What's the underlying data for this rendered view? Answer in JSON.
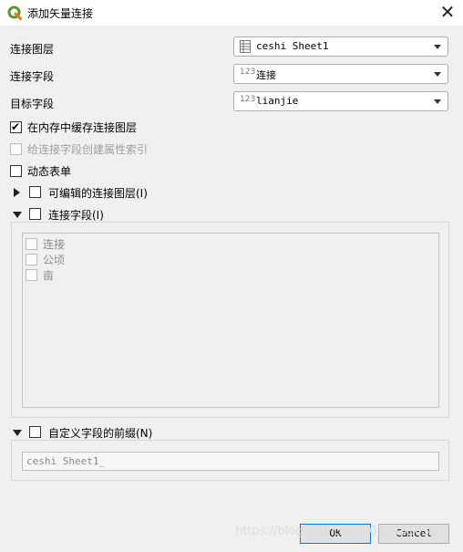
{
  "window": {
    "title": "添加矢量连接",
    "close_icon": "close-icon"
  },
  "join_layer": {
    "label": "连接图层",
    "value": "ceshi Sheet1",
    "icon": "table-icon"
  },
  "join_field": {
    "label": "连接字段",
    "value": "连接",
    "type_badge": "123"
  },
  "target_field": {
    "label": "目标字段",
    "value": "lianjie",
    "type_badge": "123"
  },
  "options": {
    "cache_in_memory": {
      "label": "在内存中缓存连接图层",
      "checked": true,
      "enabled": true
    },
    "create_index": {
      "label": "给连接字段创建属性索引",
      "checked": false,
      "enabled": false
    },
    "dynamic_form": {
      "label": "动态表单",
      "checked": false,
      "enabled": true
    }
  },
  "editable_group": {
    "label": "可编辑的连接图层(I)",
    "expanded": false,
    "checked": false
  },
  "joined_fields_group": {
    "label": "连接字段(I)",
    "expanded": true,
    "checked": false,
    "fields": [
      {
        "label": "连接",
        "checked": false
      },
      {
        "label": "公顷",
        "checked": false
      },
      {
        "label": "亩",
        "checked": false
      }
    ]
  },
  "prefix_group": {
    "label": "自定义字段的前缀(N)",
    "expanded": true,
    "checked": false,
    "prefix_value": "ceshi Sheet1_"
  },
  "buttons": {
    "ok": "OK",
    "cancel": "Cancel"
  },
  "watermark": "https://blog.csdn.net/u013481036"
}
